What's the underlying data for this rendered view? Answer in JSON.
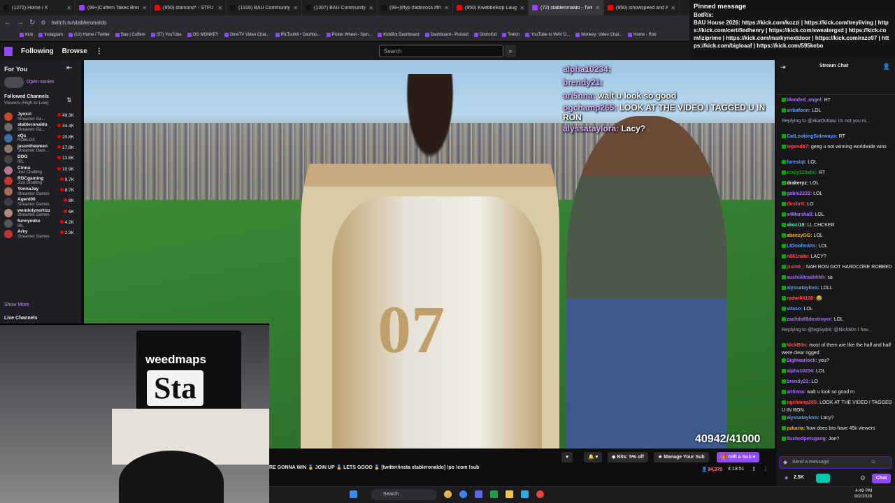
{
  "tabs": [
    {
      "title": "(1272) Home / X",
      "color": "#111111"
    },
    {
      "title": "(99+)Cuffem Takes Break A",
      "color": "#9146ff"
    },
    {
      "title": "(950) diamond* - STFU (Of",
      "color": "#ff0000"
    },
    {
      "title": "(1316) BAU Community / X",
      "color": "#111111"
    },
    {
      "title": "(1307) BAU Community / X",
      "color": "#111111"
    },
    {
      "title": "(99+)#fyp #adinross #ther",
      "color": "#111111"
    },
    {
      "title": "(950) Kwebbelkop Laugh (",
      "color": "#ff0000"
    },
    {
      "title": "(72) stableronaldo - Twitch",
      "color": "#9146ff",
      "active": true
    },
    {
      "title": "(950) ishowspeed and Aws",
      "color": "#ff0000"
    }
  ],
  "address": "twitch.tv/stableronaldo",
  "bookmarks": [
    "Kick",
    "Instagram",
    "(12) Home / Twitter",
    "Bau | Cuffem",
    "(57) YouTube",
    "OG MONKEY",
    "OmeTV Video Chat...",
    "IRLToolkit • Dashbo...",
    "Picker Wheel - Spin...",
    "KickBot Dashboard",
    "Dashboard - Pulsoid",
    "DistroKid",
    "Twitch",
    "YouTube to WAV D...",
    "Monkey: Video Chat...",
    "Home - Rob"
  ],
  "nav": {
    "following": "Following",
    "browse": "Browse",
    "more": "⋮",
    "search_placeholder": "Search"
  },
  "sidebar": {
    "for_you": "For You",
    "open_stories": "Open stories",
    "followed": "Followed Channels",
    "sort": "Viewers (High to Low)",
    "show_more": "Show More",
    "live_channels": "Live Channels",
    "channels": [
      {
        "name": "Jynxzi",
        "category": "Streamer Ga...",
        "viewers": "49.3K",
        "color": "#c44a2a"
      },
      {
        "name": "stableronaldo",
        "category": "Streamer Ga...",
        "viewers": "34.4K",
        "color": "#6a6a6a"
      },
      {
        "name": "xQc",
        "category": "ROBLOX",
        "viewers": "20.8K",
        "color": "#3a6ea5"
      },
      {
        "name": "jasontheween",
        "category": "Streamer Gam...",
        "viewers": "17.8K",
        "color": "#8a7a66"
      },
      {
        "name": "DDG",
        "category": "IRL",
        "viewers": "13.6K",
        "color": "#444444"
      },
      {
        "name": "Cinna",
        "category": "Just Chatting",
        "viewers": "10.9K",
        "color": "#b07a8a"
      },
      {
        "name": "RDCgaming",
        "category": "Just Chatting",
        "viewers": "9.7K",
        "color": "#c23b2b"
      },
      {
        "name": "YonnaJay",
        "category": "Streamer Games",
        "viewers": "8.7K",
        "color": "#a36f55"
      },
      {
        "name": "Agent00",
        "category": "Streamer Games",
        "viewers": "8K",
        "color": "#3e3e3e"
      },
      {
        "name": "wendolynortizz",
        "category": "Streamer Games",
        "viewers": "6K",
        "color": "#b08a7a"
      },
      {
        "name": "funnymike",
        "category": "IRL",
        "viewers": "4.2K",
        "color": "#555555"
      },
      {
        "name": "Arky",
        "category": "Streamer Games",
        "viewers": "2.3K",
        "color": "#c0343a"
      }
    ]
  },
  "pinned": {
    "header": "Pinned message",
    "author": "BotRix:",
    "text": "BAU House 2026: https://kick.com/kozzi | https://kick.com/treyliving | https://kick.com/certifiedhenry | https://kick.com/sweatergxd | https://kick.com/iziprime | https://kick.com/markynextdoor | https://kick.com/razo97 | https://kick.com/bigloaaf | https://kick.com/595kebo"
  },
  "overlay_chat": [
    {
      "user": "alpha10234:",
      "text": ""
    },
    {
      "user": "brendy21:",
      "text": ""
    },
    {
      "user": "ari5nna:",
      "text": "walt u look so good"
    },
    {
      "user": "ogchamp265:",
      "text": "LOOK AT THE VIDEO I TAGGED U IN RON"
    },
    {
      "user": "alyssataylora:",
      "text": "Lacy?"
    }
  ],
  "video": {
    "jersey_number": "07",
    "viewer_goal": "40942/41000"
  },
  "chat": {
    "title": "Stream Chat",
    "messages": [
      {
        "user": "blonded_angel:",
        "text": "RT",
        "color": "#a970ff"
      },
      {
        "user": "sirbafonn:",
        "text": "LOL",
        "color": "#5c9cff"
      },
      {
        "user": "",
        "text": "Replying to @akaOutlaw: its not you ni...",
        "color": "#adadb8"
      },
      {
        "user": "CatLookingSideways:",
        "text": "RT",
        "color": "#5c9cff"
      },
      {
        "user": "legendb7:",
        "text": "geeg u not winning worldwide wins",
        "color": "#ff4f4f"
      },
      {
        "user": "forestqt:",
        "text": "LOL",
        "color": "#5c9cff"
      },
      {
        "user": "crxzy123abc:",
        "text": "RT",
        "color": "#00ad03"
      },
      {
        "user": "drakeryz:",
        "text": "LOL",
        "color": "#efeff1"
      },
      {
        "user": "gabis2222:",
        "text": "LOL",
        "color": "#a970ff"
      },
      {
        "user": "thrxbrtt:",
        "text": "LO",
        "color": "#ff4f4f"
      },
      {
        "user": "x4Marshall:",
        "text": "LOL",
        "color": "#a970ff"
      },
      {
        "user": "skozi19:",
        "text": "LL CHCKER",
        "color": "#5cffb0"
      },
      {
        "user": "abeezyGG:",
        "text": "LOL",
        "color": "#ffb31a"
      },
      {
        "user": "LtDoofentits:",
        "text": "LOL",
        "color": "#5c9cff"
      },
      {
        "user": "n661nate:",
        "text": "LACY?",
        "color": "#ff4f4f"
      },
      {
        "user": "j1sm0_:",
        "text": "NAH RON GOT HARDCORE ROBBED",
        "color": "#ff4f4f"
      },
      {
        "user": "sushiiiitrashhhh:",
        "text": "sa",
        "color": "#a970ff"
      },
      {
        "user": "alyssataylora:",
        "text": "LOLL",
        "color": "#5c9cff"
      },
      {
        "user": "rodwill4100:",
        "text": "😂",
        "color": "#ff4f4f"
      },
      {
        "user": "vitaso:",
        "text": "LOL",
        "color": "#5c9cff"
      },
      {
        "user": "zachde69destroyer:",
        "text": "LOL",
        "color": "#a970ff"
      },
      {
        "user": "",
        "text": "Replying to @lvgSydni: @Nick80n I hav...",
        "color": "#adadb8"
      },
      {
        "user": "NickB0n:",
        "text": "most of them are like the half and half were clear rigged",
        "color": "#ff4f4f"
      },
      {
        "user": "Sighwarlock:",
        "text": "you?",
        "color": "#a970ff"
      },
      {
        "user": "alpha10234:",
        "text": "LOL",
        "color": "#a970ff"
      },
      {
        "user": "brendy21:",
        "text": "LO",
        "color": "#a970ff"
      },
      {
        "user": "ari5nna:",
        "text": "walt u look so good rn",
        "color": "#a970ff"
      },
      {
        "user": "ogchamp265:",
        "text": "LOOK AT THE VIDEO I TAGGED U IN RON",
        "color": "#ff4f4f"
      },
      {
        "user": "alyssataylora:",
        "text": "Lacy?",
        "color": "#5c9cff"
      },
      {
        "user": "pzkaria:",
        "text": "how does bro have 45k viewers",
        "color": "#ffb31a"
      },
      {
        "user": "llushedpetsgang:",
        "text": "Joe?",
        "color": "#a970ff"
      }
    ],
    "input_placeholder": "Send a message",
    "points": "2.5K",
    "chat_button": "Chat"
  },
  "stream_bar": {
    "title": "RE GONNA WIN 🏅 JOIN UP 🏅 LETS GOOO 🏅 [twitter/insta stableronaldo] !po !com !sub",
    "bits": "Bits: 5% off",
    "manage_sub": "Manage Your Sub",
    "gift_sub": "Gift a Sub",
    "viewer_count": "34,370",
    "uptime": "4:13:51"
  },
  "webcam": {
    "banner_brand": "weedmaps",
    "banner_text": "Sta"
  },
  "taskbar": {
    "search": "Search",
    "time": "4:49 PM",
    "date": "8/2/2026"
  },
  "colors": {
    "twitch_purple": "#9146ff",
    "live_red": "#eb0400",
    "viewer_red": "#ff6e6e"
  }
}
